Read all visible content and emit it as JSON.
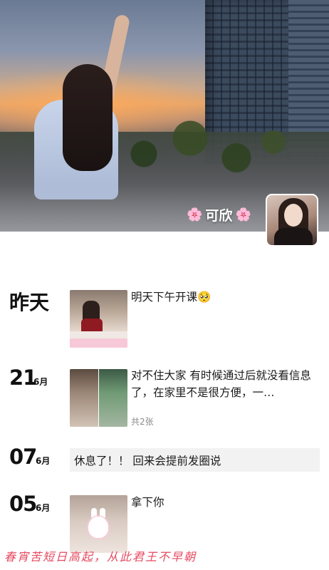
{
  "profile": {
    "name": "可欣",
    "name_decoration": "🌸"
  },
  "posts": [
    {
      "date_text": "昨天",
      "text": "明天下午开课🥺",
      "image_count_text": ""
    },
    {
      "day": "21",
      "month": "6月",
      "text": "对不住大家 有时候通过后就没看信息了，在家里不是很方便，一…",
      "image_count_text": "共2张"
    },
    {
      "day": "07",
      "month": "6月",
      "text": "休息了！！ 回来会提前发圈说"
    },
    {
      "day": "05",
      "month": "6月",
      "text": "拿下你"
    }
  ],
  "watermark": "春宵苦短日高起，从此君王不早朝"
}
